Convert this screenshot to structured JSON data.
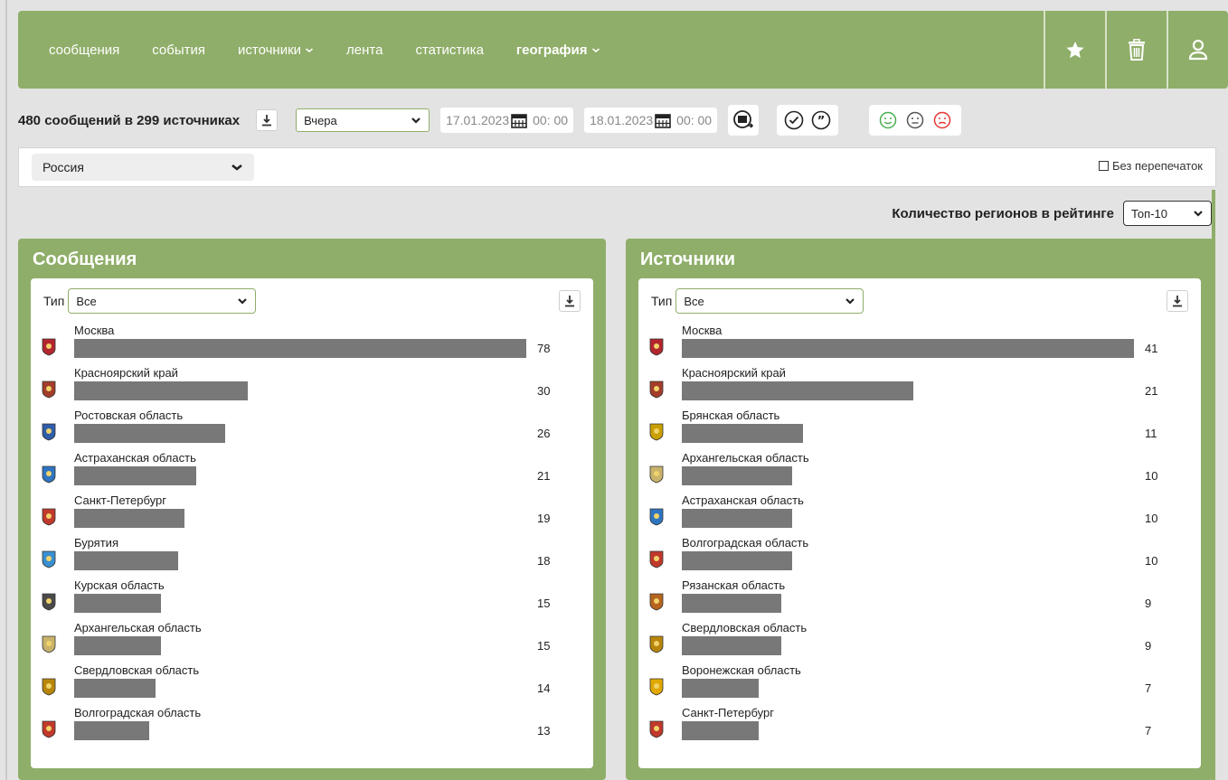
{
  "nav": {
    "items": [
      {
        "label": "сообщения",
        "active": false,
        "dropdown": false
      },
      {
        "label": "события",
        "active": false,
        "dropdown": false
      },
      {
        "label": "источники",
        "active": false,
        "dropdown": true
      },
      {
        "label": "лента",
        "active": false,
        "dropdown": false
      },
      {
        "label": "статистика",
        "active": false,
        "dropdown": false
      },
      {
        "label": "география",
        "active": true,
        "dropdown": true
      }
    ],
    "icons": [
      "star-icon",
      "trash-icon",
      "user-icon"
    ]
  },
  "filters": {
    "summary": "480 сообщений в 299 источниках",
    "period": "Вчера",
    "date_from": "17.01.2023",
    "time_from": "00: 00",
    "date_to": "18.01.2023",
    "time_to": "00: 00"
  },
  "region_filter": {
    "selected": "Россия",
    "no_reprints_label": "Без перепечаток"
  },
  "rating": {
    "label": "Количество регионов в рейтинге",
    "selected": "Топ-10"
  },
  "colors": {
    "accent": "#8fae69",
    "bar": "#787878",
    "positive": "#4caf50",
    "neutral": "#555555",
    "negative": "#e53935"
  },
  "messages_panel": {
    "title": "Сообщения",
    "type_label": "Тип",
    "type_selected": "Все",
    "max": 78,
    "items": [
      {
        "name": "Москва",
        "value": "78",
        "num": 78,
        "color": "#b3262e"
      },
      {
        "name": "Красноярский край",
        "value": "30",
        "num": 30,
        "color": "#a33d2a"
      },
      {
        "name": "Ростовская область",
        "value": "26",
        "num": 26,
        "color": "#2f5da8"
      },
      {
        "name": "Астраханская область",
        "value": "21",
        "num": 21,
        "color": "#2f74c0"
      },
      {
        "name": "Санкт-Петербург",
        "value": "19",
        "num": 19,
        "color": "#c0392b"
      },
      {
        "name": "Бурятия",
        "value": "18",
        "num": 18,
        "color": "#3a8fd0"
      },
      {
        "name": "Курская область",
        "value": "15",
        "num": 15,
        "color": "#4a4a4a"
      },
      {
        "name": "Архангельская область",
        "value": "15",
        "num": 15,
        "color": "#c9b36b"
      },
      {
        "name": "Свердловская область",
        "value": "14",
        "num": 14,
        "color": "#b8860b"
      },
      {
        "name": "Волгоградская область",
        "value": "13",
        "num": 13,
        "color": "#c0392b"
      }
    ]
  },
  "sources_panel": {
    "title": "Источники",
    "type_label": "Тип",
    "type_selected": "Все",
    "max": 41,
    "items": [
      {
        "name": "Москва",
        "value": "41",
        "num": 41,
        "color": "#b3262e"
      },
      {
        "name": "Красноярский край",
        "value": "21",
        "num": 21,
        "color": "#a33d2a"
      },
      {
        "name": "Брянская область",
        "value": "11",
        "num": 11,
        "color": "#c8a000"
      },
      {
        "name": "Архангельская область",
        "value": "10",
        "num": 10,
        "color": "#c9b36b"
      },
      {
        "name": "Астраханская область",
        "value": "10",
        "num": 10,
        "color": "#2f74c0"
      },
      {
        "name": "Волгоградская область",
        "value": "10",
        "num": 10,
        "color": "#c0392b"
      },
      {
        "name": "Рязанская область",
        "value": "9",
        "num": 9,
        "color": "#b5651d"
      },
      {
        "name": "Свердловская область",
        "value": "9",
        "num": 9,
        "color": "#b8860b"
      },
      {
        "name": "Воронежская область",
        "value": "7",
        "num": 7,
        "color": "#e0a800"
      },
      {
        "name": "Санкт-Петербург",
        "value": "7",
        "num": 7,
        "color": "#c0392b"
      }
    ]
  }
}
